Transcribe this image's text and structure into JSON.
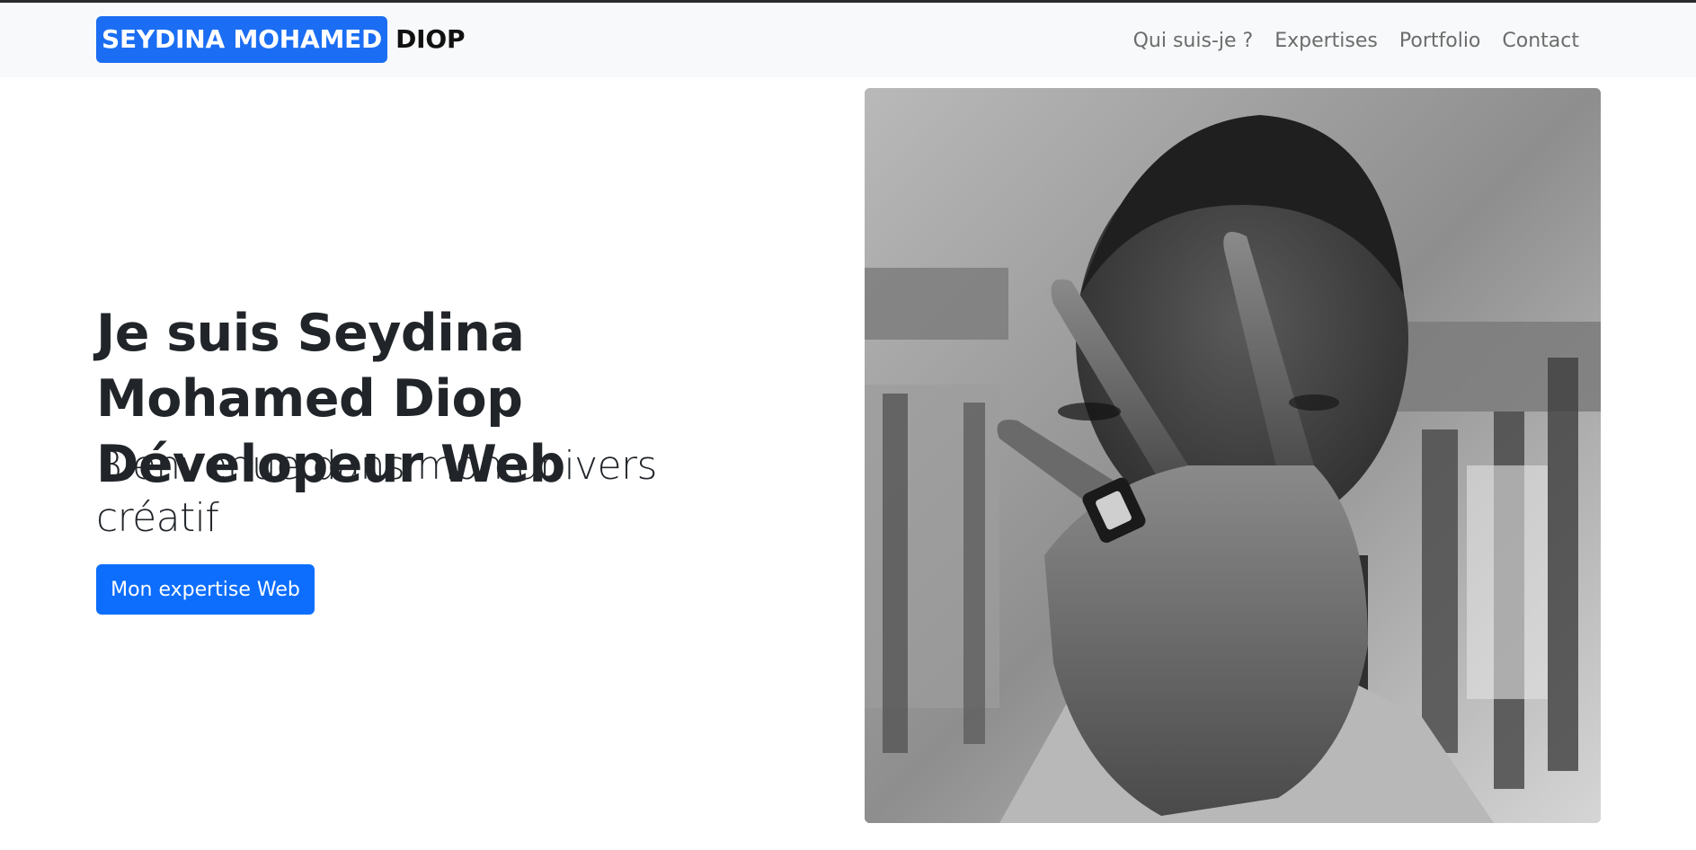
{
  "navbar": {
    "brand_highlight": "SEYDINA MOHAMED",
    "brand_rest": "DIOP",
    "links": [
      "Qui suis-je ?",
      "Expertises",
      "Portfolio",
      "Contact"
    ]
  },
  "hero": {
    "title": "Je suis Seydina Mohamed Diop Dévelopeur Web",
    "subtitle": "Bienvenue dans mon univers créatif",
    "cta_label": "Mon expertise Web"
  },
  "colors": {
    "brand_accent": "#1b6ef3",
    "button": "#0d6efd",
    "navbar_bg": "#f8f9fa",
    "nav_link": "#6c6c6c"
  }
}
